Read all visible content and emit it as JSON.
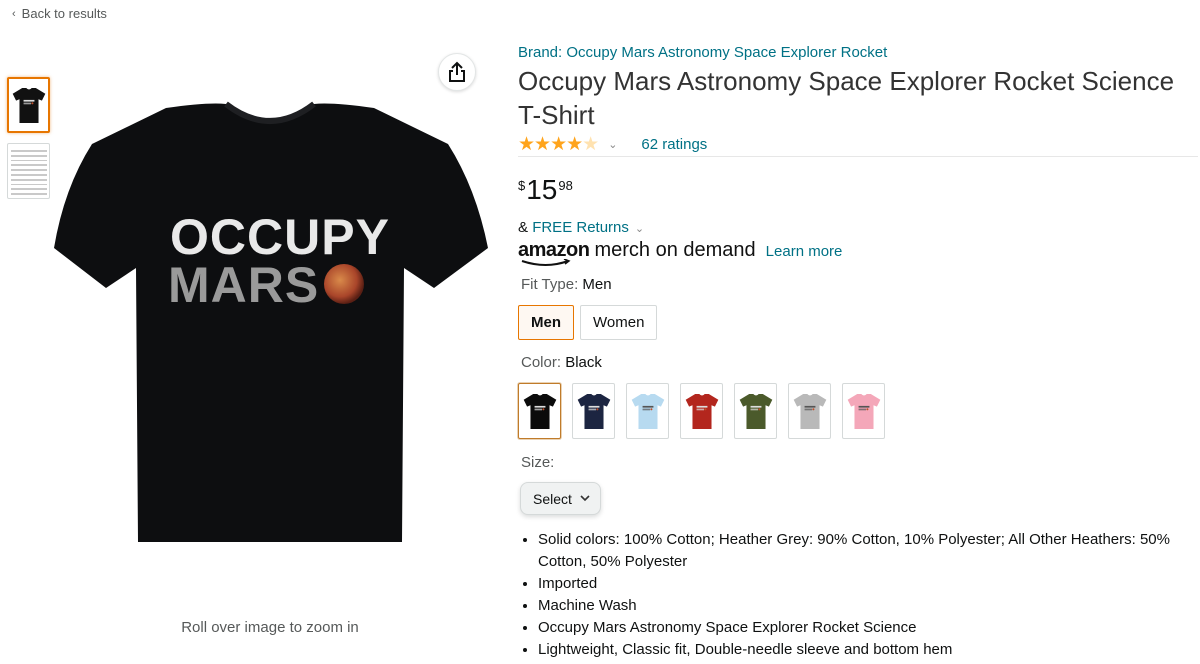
{
  "nav": {
    "back_label": "Back to results"
  },
  "gallery": {
    "zoom_hint": "Roll over image to zoom in",
    "shirt_text_line1": "OCCUPY",
    "shirt_text_line2": "MARS"
  },
  "product": {
    "brand": "Brand: Occupy Mars Astronomy Space Explorer Rocket",
    "title": "Occupy Mars Astronomy Space Explorer Rocket Science T-Shirt",
    "rating_value": 4.5,
    "ratings_count": "62 ratings",
    "price": {
      "symbol": "$",
      "whole": "15",
      "fraction": "98"
    },
    "returns_prefix": "& ",
    "returns_link": "FREE Returns",
    "merch_brand": "amazon",
    "merch_suffix": "merch on demand",
    "learn_more": "Learn more",
    "fit_label": "Fit Type: ",
    "fit_value": "Men",
    "fit_options": [
      "Men",
      "Women"
    ],
    "color_label": "Color: ",
    "color_value": "Black",
    "color_swatches": [
      {
        "name": "Black",
        "hex": "#0b0b0b"
      },
      {
        "name": "Navy",
        "hex": "#1c2541"
      },
      {
        "name": "Baby Blue",
        "hex": "#b7daf0"
      },
      {
        "name": "Red",
        "hex": "#b3261e"
      },
      {
        "name": "Olive",
        "hex": "#4b5a2b"
      },
      {
        "name": "Heather Grey",
        "hex": "#b9b9b9"
      },
      {
        "name": "Pink",
        "hex": "#f4a7b9"
      }
    ],
    "size_label": "Size:",
    "size_select": "Select",
    "bullets": [
      "Solid colors: 100% Cotton; Heather Grey: 90% Cotton, 10% Polyester; All Other Heathers: 50% Cotton, 50% Polyester",
      "Imported",
      "Machine Wash",
      "Occupy Mars Astronomy Space Explorer Rocket Science",
      "Lightweight, Classic fit, Double-needle sleeve and bottom hem"
    ]
  },
  "colors": {
    "link": "#007185",
    "star": "#ffa41c",
    "selected_border": "#e77600"
  }
}
